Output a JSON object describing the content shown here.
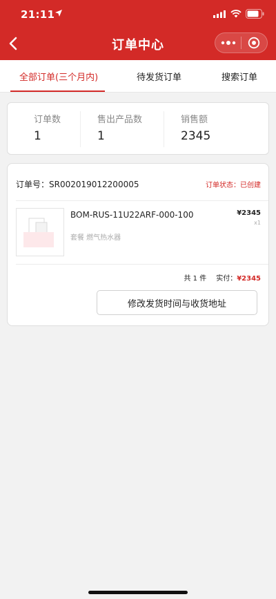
{
  "status_bar": {
    "time": "21:11"
  },
  "nav": {
    "title": "订单中心"
  },
  "tabs": [
    {
      "label": "全部订单(三个月内)",
      "active": true
    },
    {
      "label": "待发货订单",
      "active": false
    },
    {
      "label": "搜索订单",
      "active": false
    }
  ],
  "stats": [
    {
      "label": "订单数",
      "value": "1"
    },
    {
      "label": "售出产品数",
      "value": "1"
    },
    {
      "label": "销售额",
      "value": "2345"
    }
  ],
  "order": {
    "number_label": "订单号：SR002019012200005",
    "status_label": "订单状态：已创建",
    "product_name": "BOM-RUS-11U22ARF-000-100",
    "product_desc": "套餐      燃气热水器",
    "price": "¥2345",
    "qty": "x1",
    "count_label": "共 1 件",
    "paid_label": "实付：",
    "paid_amount": "¥2345",
    "modify_button": "修改发货时间与收货地址"
  },
  "colors": {
    "brand": "#d32a27"
  }
}
